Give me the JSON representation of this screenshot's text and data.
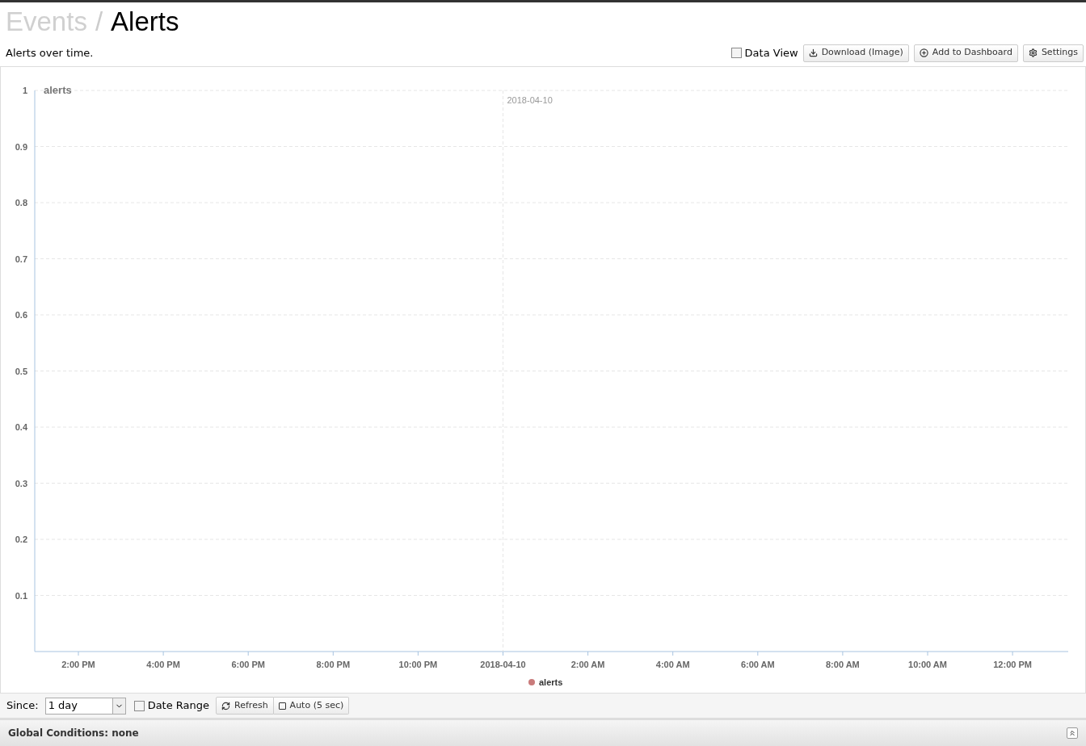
{
  "breadcrumb": [
    {
      "label": "Events",
      "current": false
    },
    {
      "label": "Alerts",
      "current": true
    }
  ],
  "separator": "/",
  "description": "Alerts over time.",
  "toolbar": {
    "data_view": {
      "label": "Data View",
      "checked": false
    },
    "buttons": [
      {
        "kind": "download",
        "label": "Download (Image)"
      },
      {
        "kind": "add",
        "label": "Add to Dashboard"
      },
      {
        "kind": "settings",
        "label": "Settings"
      }
    ]
  },
  "chart_data": {
    "type": "line",
    "title": "alerts",
    "categories": [
      "2:00 PM",
      "4:00 PM",
      "6:00 PM",
      "8:00 PM",
      "10:00 PM",
      "2018-04-10",
      "2:00 AM",
      "4:00 AM",
      "6:00 AM",
      "8:00 AM",
      "10:00 AM",
      "12:00 PM"
    ],
    "ylim": [
      0,
      1
    ],
    "yticks": [
      0.1,
      0.2,
      0.3,
      0.4,
      0.5,
      0.6,
      0.7,
      0.8,
      0.9,
      {
        "value": 1,
        "label": "1"
      }
    ],
    "series": [
      {
        "name": "alerts",
        "color": "#c97b7b",
        "values": [
          null,
          null,
          null,
          null,
          null,
          null,
          null,
          null,
          null,
          null,
          null,
          null
        ]
      }
    ],
    "grid": true,
    "annotations": [
      "2018-04-10"
    ]
  },
  "controls": {
    "since_label": "Since:",
    "since_value": "1 day",
    "date_range": {
      "label": "Date Range",
      "checked": false
    },
    "refresh": "Refresh",
    "auto": {
      "label": "Auto (5 sec)",
      "checked": false
    }
  },
  "global_conditions": "Global Conditions: none"
}
